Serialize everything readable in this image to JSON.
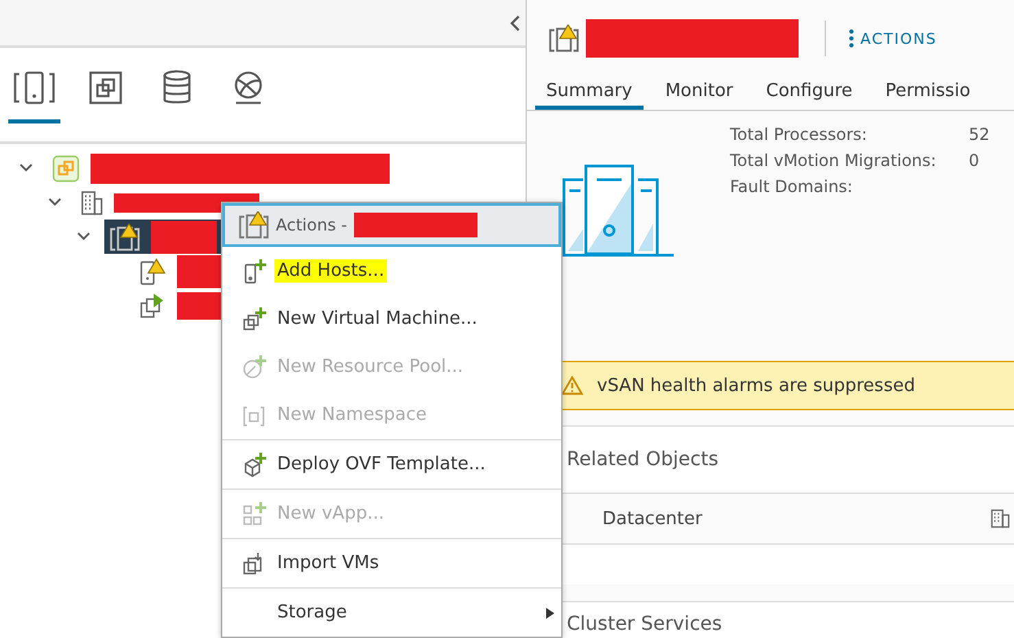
{
  "nav_tabs": [
    {
      "kind": "hosts",
      "selected": true
    },
    {
      "kind": "vms",
      "selected": false
    },
    {
      "kind": "storage",
      "selected": false
    },
    {
      "kind": "network",
      "selected": false
    }
  ],
  "tree": [
    {
      "kind": "vcenter",
      "expanded": true,
      "selected": false,
      "redacted": true,
      "children": [
        {
          "kind": "datacenter",
          "expanded": true,
          "selected": false,
          "redacted": true,
          "children": [
            {
              "kind": "cluster",
              "expanded": true,
              "selected": true,
              "warning": true,
              "redacted": true,
              "children": [
                {
                  "kind": "host",
                  "selected": false,
                  "warning": true,
                  "redacted": true
                },
                {
                  "kind": "vm",
                  "selected": false,
                  "redacted": true
                }
              ]
            }
          ]
        }
      ]
    }
  ],
  "context_menu": {
    "title": "Actions -",
    "title_redacted": true,
    "items": [
      {
        "kind": "add-host",
        "label": "Add Hosts...",
        "disabled": false,
        "highlighted": true,
        "separator_before": false,
        "submenu": false
      },
      {
        "kind": "new-vm",
        "label": "New Virtual Machine...",
        "disabled": false,
        "highlighted": false,
        "separator_before": false,
        "submenu": false
      },
      {
        "kind": "resource-pool",
        "label": "New Resource Pool...",
        "disabled": true,
        "highlighted": false,
        "separator_before": false,
        "submenu": false
      },
      {
        "kind": "namespace",
        "label": "New Namespace",
        "disabled": true,
        "highlighted": false,
        "separator_before": false,
        "submenu": false
      },
      {
        "kind": "deploy-ovf",
        "label": "Deploy OVF Template...",
        "disabled": false,
        "highlighted": false,
        "separator_before": true,
        "submenu": false
      },
      {
        "kind": "vapp",
        "label": "New vApp...",
        "disabled": true,
        "highlighted": false,
        "separator_before": true,
        "submenu": false
      },
      {
        "kind": "import-vms",
        "label": "Import VMs",
        "disabled": false,
        "highlighted": false,
        "separator_before": true,
        "submenu": false
      },
      {
        "kind": "none",
        "label": "Storage",
        "disabled": false,
        "highlighted": false,
        "separator_before": true,
        "submenu": true
      }
    ]
  },
  "object_header": {
    "name_redacted": true,
    "warning": true,
    "actions_label": "ACTIONS"
  },
  "tabs": [
    {
      "label": "Summary",
      "selected": true
    },
    {
      "label": "Monitor",
      "selected": false
    },
    {
      "label": "Configure",
      "selected": false
    },
    {
      "label": "Permissio",
      "selected": false
    }
  ],
  "summary": [
    {
      "label": "Total Processors:",
      "value": "52"
    },
    {
      "label": "Total vMotion Migrations:",
      "value": "0"
    },
    {
      "label": "Fault Domains:"
    }
  ],
  "alert": {
    "text": "vSAN health alarms are suppressed"
  },
  "related_objects": {
    "title": "Related Objects",
    "rows": [
      {
        "label": "Datacenter"
      }
    ]
  },
  "cluster_services": {
    "title": "Cluster Services"
  }
}
